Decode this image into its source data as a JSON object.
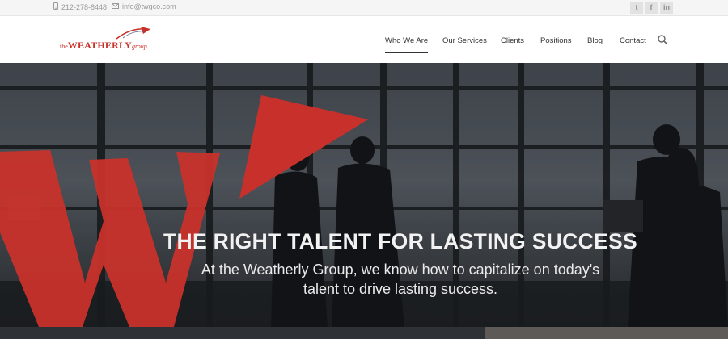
{
  "topbar": {
    "phone": "212-278-8448",
    "email": "info@twgco.com",
    "phone_icon": "phone-icon",
    "email_icon": "envelope-icon",
    "social": [
      {
        "name": "twitter-icon",
        "glyph": "t"
      },
      {
        "name": "facebook-icon",
        "glyph": "f"
      },
      {
        "name": "linkedin-icon",
        "glyph": "in"
      }
    ]
  },
  "logo": {
    "the": "the",
    "main": "WEATHERLY",
    "group": "group",
    "color": "#c8312b"
  },
  "nav": {
    "items": [
      "Who We Are",
      "Our Services",
      "Clients",
      "Positions",
      "Blog",
      "Contact"
    ],
    "active": "Who We Are",
    "search_icon": "search-icon"
  },
  "hero": {
    "title": "THE RIGHT TALENT FOR LASTING SUCCESS",
    "subtitle": "At the Weatherly Group, we know how to capitalize on today's talent to drive lasting success.",
    "accent": "#c8312b"
  }
}
